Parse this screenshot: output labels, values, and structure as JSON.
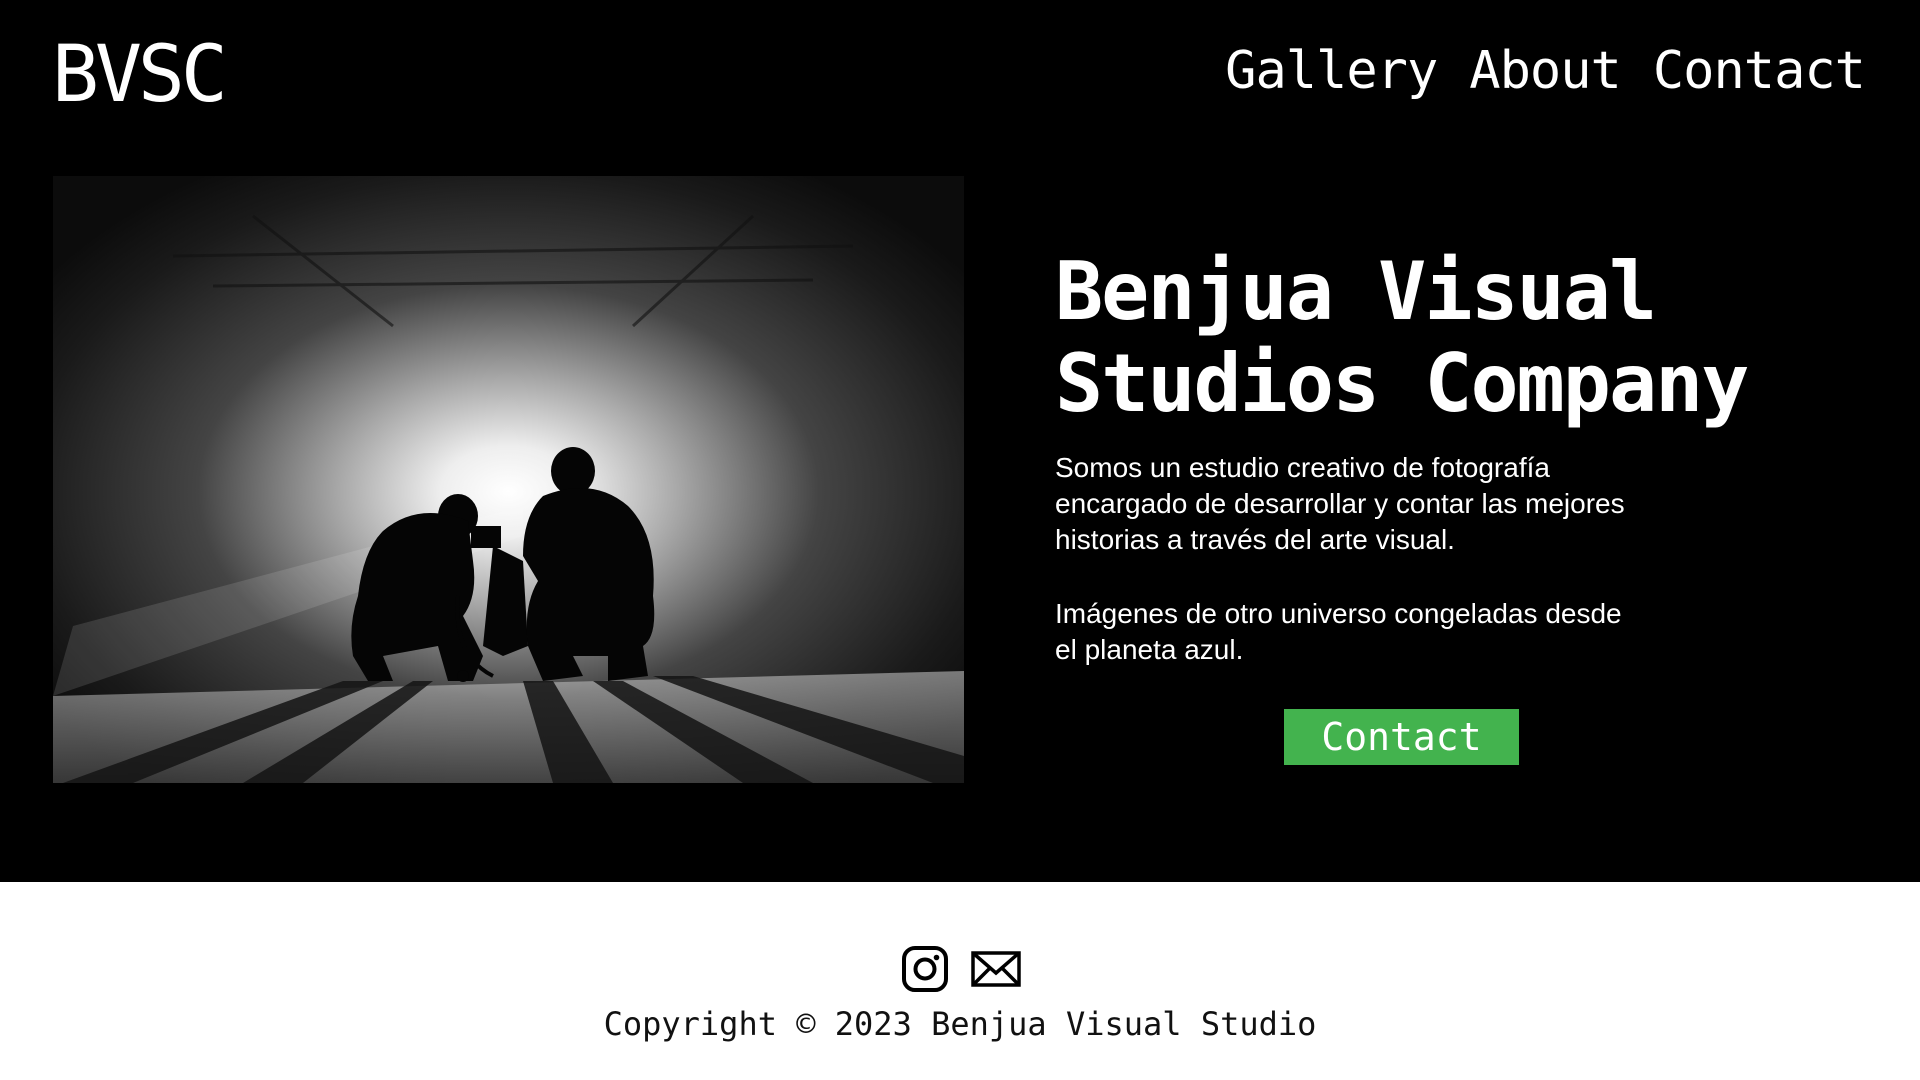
{
  "brand": {
    "logo_text": "BVSC"
  },
  "nav": {
    "items": [
      {
        "label": "Gallery"
      },
      {
        "label": "About"
      },
      {
        "label": "Contact"
      }
    ]
  },
  "hero": {
    "title_line_1": "Benjua Visual",
    "title_line_2": "Studios Company",
    "description": "Somos un estudio creativo de fotografía\nencargado de desarrollar y contar las mejores\nhistorias a través del arte visual.",
    "tagline": "Imágenes de otro universo congeladas desde\n el planeta azul.",
    "cta_label": "Contact",
    "image_icon": "photo-silhouettes"
  },
  "footer": {
    "social": [
      {
        "icon": "instagram-icon"
      },
      {
        "icon": "mail-icon"
      }
    ],
    "copyright": "Copyright © 2023 Benjua Visual Studio"
  },
  "colors": {
    "background": "#000000",
    "footer_background": "#ffffff",
    "accent": "#43b34e",
    "text": "#ffffff"
  }
}
